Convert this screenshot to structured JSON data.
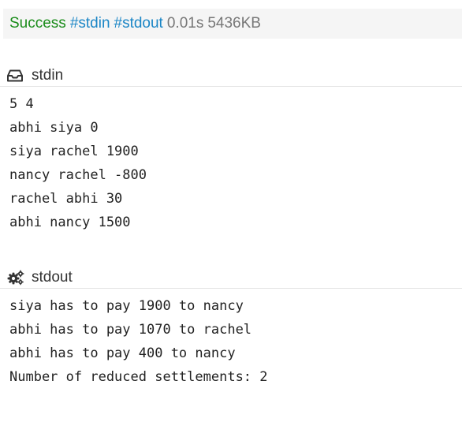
{
  "status": {
    "result": "Success",
    "tags": [
      "#stdin",
      "#stdout"
    ],
    "time": "0.01s",
    "memory": "5436KB"
  },
  "stdin": {
    "title": "stdin",
    "icon": "inbox-icon",
    "lines": [
      "5 4",
      "abhi siya 0",
      "siya rachel 1900",
      "nancy rachel -800",
      "rachel abhi 30",
      "abhi nancy 1500"
    ]
  },
  "stdout": {
    "title": "stdout",
    "icon": "gears-icon",
    "lines": [
      "siya has to pay 1900 to nancy",
      "abhi has to pay 1070 to rachel",
      "abhi has to pay 400 to nancy",
      "Number of reduced settlements: 2"
    ]
  },
  "colors": {
    "success": "#1a8c1a",
    "tag": "#1b86c6",
    "meta": "#777777",
    "status_bg": "#f5f5f5"
  }
}
